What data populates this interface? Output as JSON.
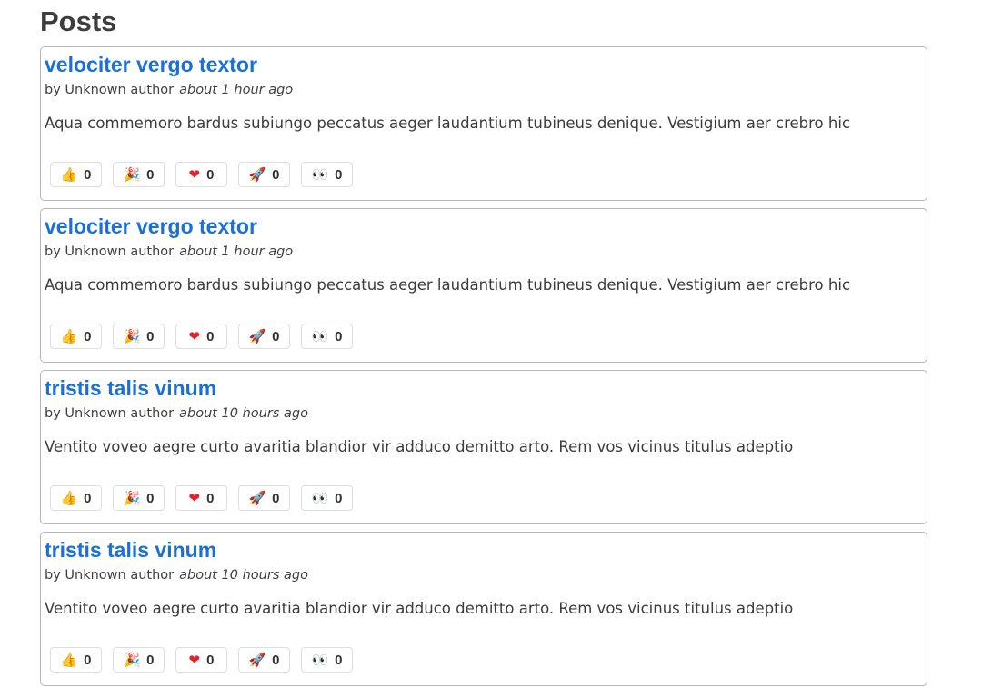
{
  "page": {
    "title": "Posts"
  },
  "reaction_types": [
    {
      "name": "thumbs-up",
      "icon": "👍",
      "color": "#f0b429"
    },
    {
      "name": "party-popper",
      "icon": "🎉",
      "color": "#7b5aa6"
    },
    {
      "name": "heart",
      "icon": "❤",
      "color": "#e0242f"
    },
    {
      "name": "rocket",
      "icon": "🚀",
      "color": "#c23b5a"
    },
    {
      "name": "eyes",
      "icon": "👀",
      "color": "#222222"
    }
  ],
  "posts": [
    {
      "title": "velociter vergo textor",
      "author": "by Unknown author",
      "time": "about 1 hour ago",
      "excerpt": "Aqua commemoro bardus subiungo peccatus aeger laudantium tubineus denique. Vestigium aer crebro hic",
      "reactions": [
        "0",
        "0",
        "0",
        "0",
        "0"
      ]
    },
    {
      "title": "velociter vergo textor",
      "author": "by Unknown author",
      "time": "about 1 hour ago",
      "excerpt": "Aqua commemoro bardus subiungo peccatus aeger laudantium tubineus denique. Vestigium aer crebro hic",
      "reactions": [
        "0",
        "0",
        "0",
        "0",
        "0"
      ]
    },
    {
      "title": "tristis talis vinum",
      "author": "by Unknown author",
      "time": "about 10 hours ago",
      "excerpt": "Ventito voveo aegre curto avaritia blandior vir adduco demitto arto. Rem vos vicinus titulus adeptio",
      "reactions": [
        "0",
        "0",
        "0",
        "0",
        "0"
      ]
    },
    {
      "title": "tristis talis vinum",
      "author": "by Unknown author",
      "time": "about 10 hours ago",
      "excerpt": "Ventito voveo aegre curto avaritia blandior vir adduco demitto arto. Rem vos vicinus titulus adeptio",
      "reactions": [
        "0",
        "0",
        "0",
        "0",
        "0"
      ]
    }
  ],
  "colors": {
    "link": "#1a6fd9",
    "heading": "#3d3d3d",
    "card_border": "#b7b7b7"
  }
}
